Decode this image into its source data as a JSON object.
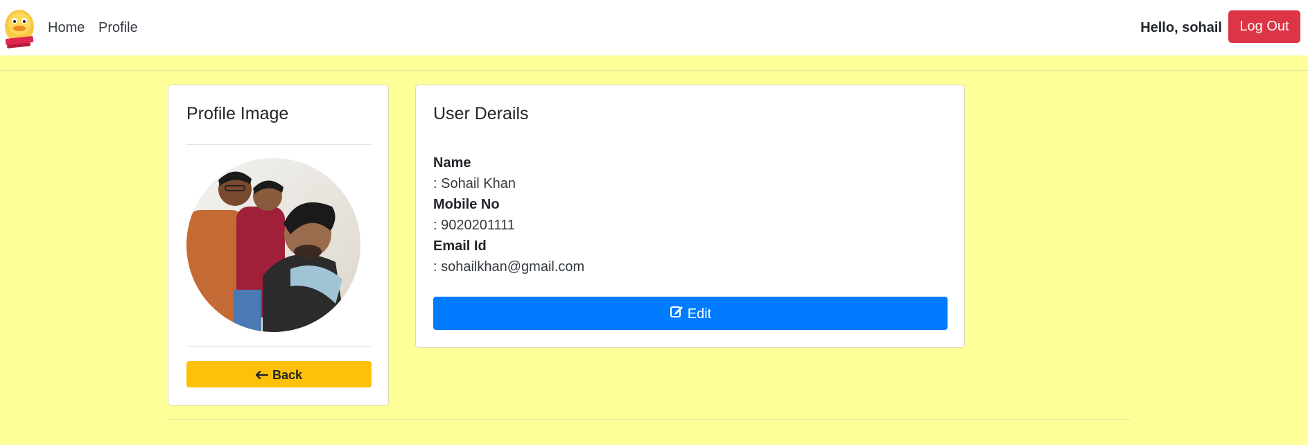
{
  "navbar": {
    "logo_icon": "duck-logo-icon",
    "links": [
      {
        "label": "Home"
      },
      {
        "label": "Profile"
      }
    ],
    "greeting": "Hello, sohail",
    "logout_label": "Log Out"
  },
  "profile_card": {
    "title": "Profile Image",
    "avatar_icon": "profile-photo",
    "back_label": "Back",
    "back_icon": "arrow-left-icon"
  },
  "user_card": {
    "title": "User Derails",
    "fields": [
      {
        "label": "Name",
        "value": ": Sohail Khan"
      },
      {
        "label": "Mobile No",
        "value": ": 9020201111"
      },
      {
        "label": "Email Id",
        "value": ": sohailkhan@gmail.com"
      }
    ],
    "edit_label": "Edit",
    "edit_icon": "edit-icon"
  },
  "colors": {
    "page_background": "#ffff99",
    "logout": "#dc3545",
    "edit": "#007bff",
    "back": "#ffc107"
  }
}
